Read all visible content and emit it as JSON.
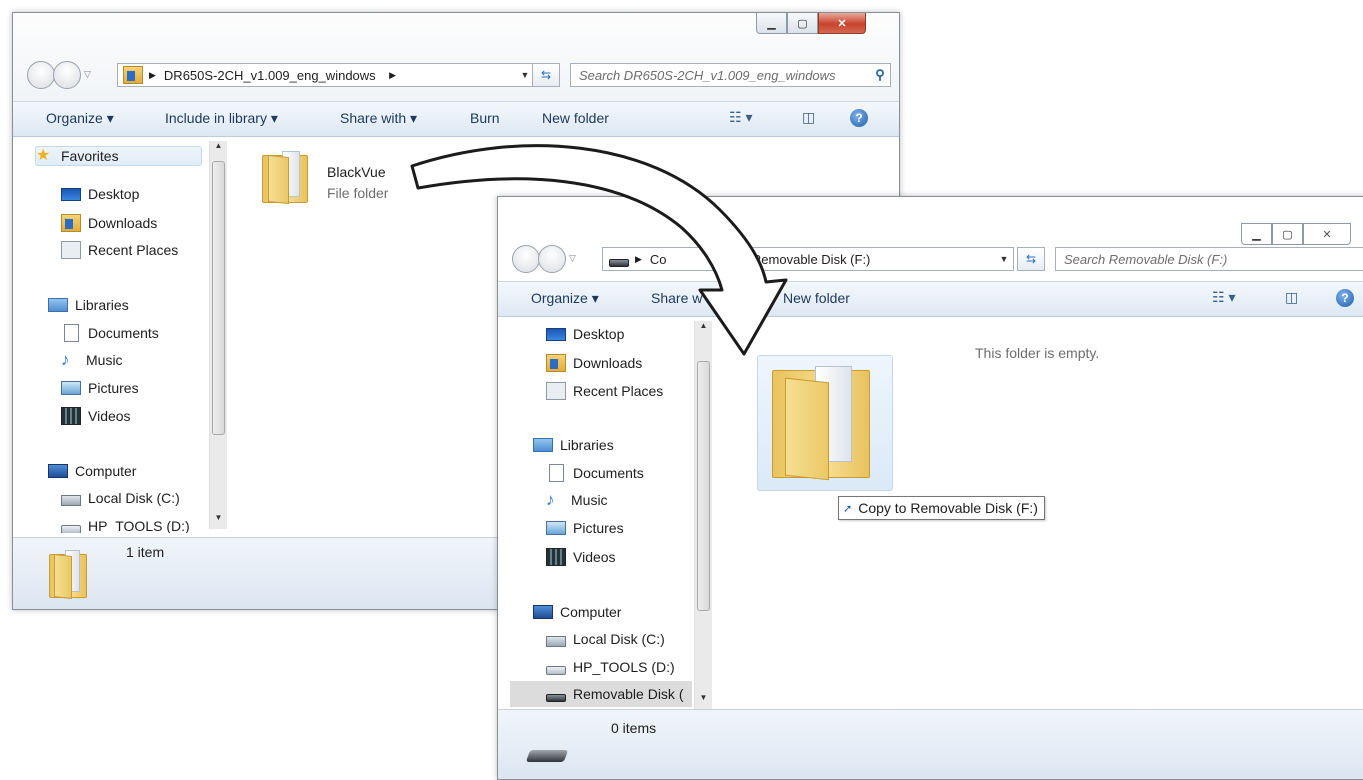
{
  "window1": {
    "address": {
      "path": "DR650S-2CH_v1.009_eng_windows"
    },
    "search": {
      "placeholder": "Search DR650S-2CH_v1.009_eng_windows"
    },
    "toolbar": {
      "organize": "Organize ▾",
      "include": "Include in library ▾",
      "share": "Share with ▾",
      "burn": "Burn",
      "new_folder": "New folder"
    },
    "nav": {
      "favorites": "Favorites",
      "desktop": "Desktop",
      "downloads": "Downloads",
      "recent": "Recent Places",
      "libraries": "Libraries",
      "documents": "Documents",
      "music": "Music",
      "pictures": "Pictures",
      "videos": "Videos",
      "computer": "Computer",
      "local_disk": "Local Disk (C:)",
      "hp_tools": "HP_TOOLS (D:)"
    },
    "file": {
      "name": "BlackVue",
      "type": "File folder"
    },
    "status": {
      "count": "1 item"
    }
  },
  "window2": {
    "address": {
      "prefix": "Co",
      "path": "Removable Disk (F:)"
    },
    "search": {
      "placeholder": "Search Removable Disk (F:)"
    },
    "toolbar": {
      "organize": "Organize ▾",
      "share": "Share w",
      "new_folder": "New folder"
    },
    "nav": {
      "desktop": "Desktop",
      "downloads": "Downloads",
      "recent": "Recent Places",
      "libraries": "Libraries",
      "documents": "Documents",
      "music": "Music",
      "pictures": "Pictures",
      "videos": "Videos",
      "computer": "Computer",
      "local_disk": "Local Disk (C:)",
      "hp_tools": "HP_TOOLS (D:)",
      "removable": "Removable Disk ("
    },
    "empty_message": "This folder is empty.",
    "drag_tooltip": "Copy to Removable Disk (F:)",
    "status": {
      "count": "0 items"
    }
  },
  "icons": {
    "minimize": "minimize-icon",
    "maximize": "maximize-icon",
    "close": "close-icon",
    "back": "back-icon",
    "forward": "forward-icon",
    "refresh": "refresh-icon",
    "search": "search-icon",
    "views": "views-icon",
    "preview_pane": "preview-pane-icon",
    "help": "help-icon",
    "drag_arrow": "drag-arrow-icon"
  },
  "colors": {
    "accent": "#1e395b",
    "close_button": "#c8432c",
    "folder": "#f2d47c"
  }
}
